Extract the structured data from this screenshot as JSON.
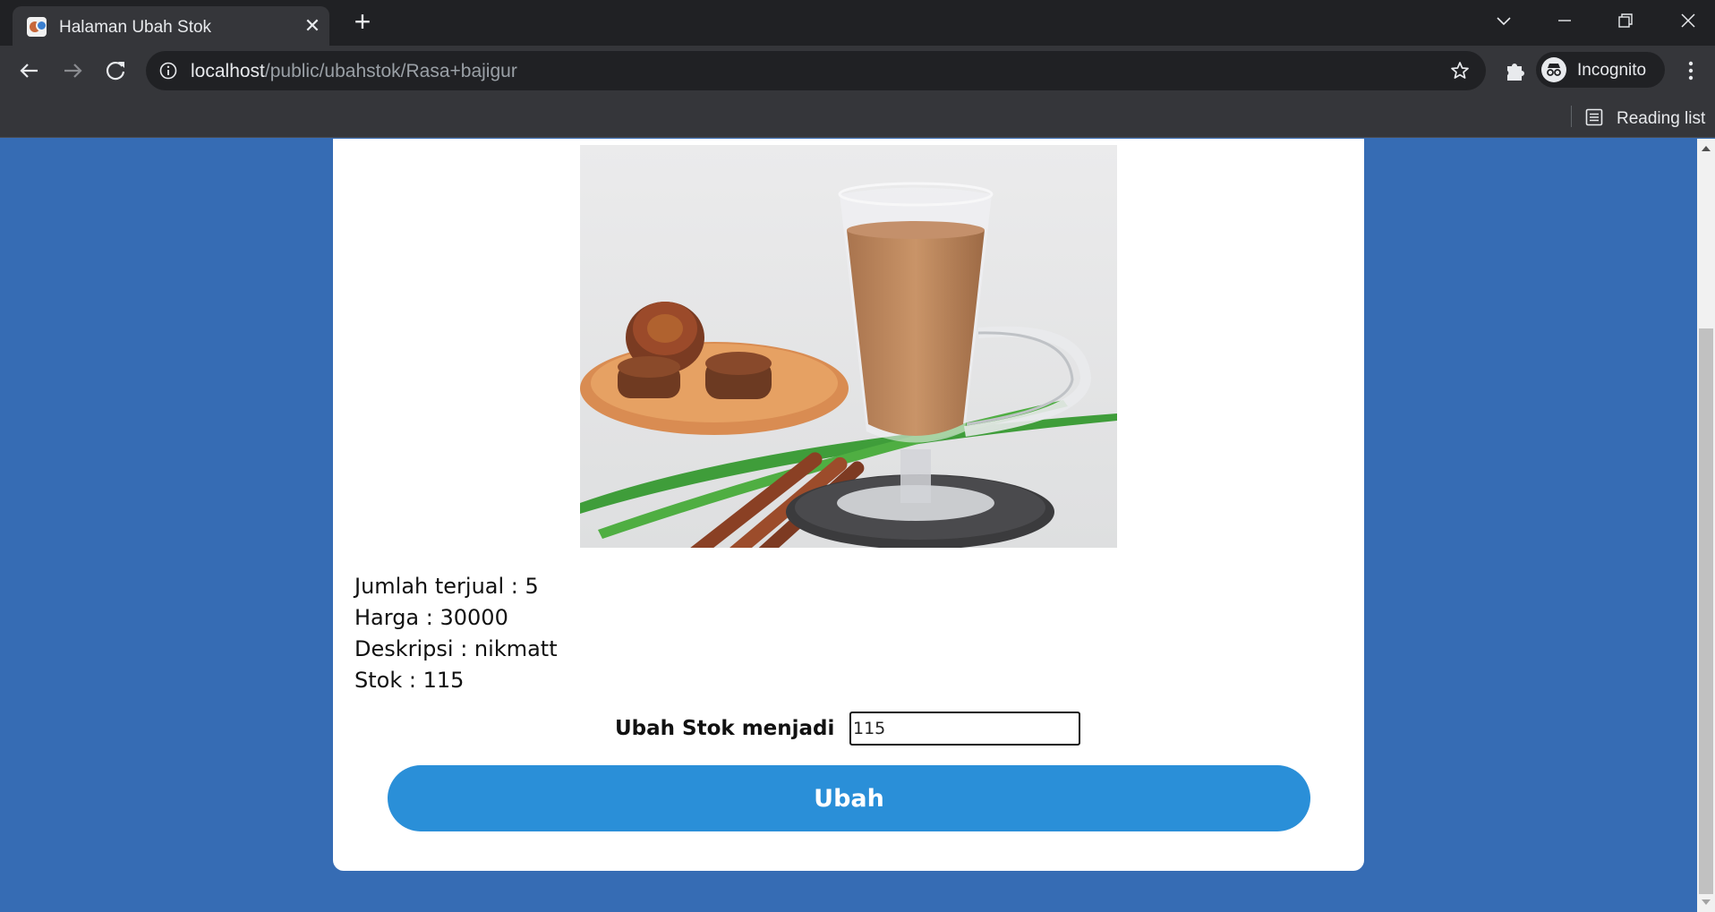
{
  "browser": {
    "tab_title": "Halaman Ubah Stok",
    "url_host": "localhost",
    "url_path": "/public/ubahstok/Rasa+bajigur",
    "profile_label": "Incognito",
    "reading_list_label": "Reading list"
  },
  "product": {
    "image_icon": "product-photo-bajigur",
    "sold_label": "Jumlah terjual : 5",
    "price_label": "Harga : 30000",
    "description_label": "Deskripsi : nikmatt",
    "stock_label": "Stok : 115"
  },
  "form": {
    "label": "Ubah Stok menjadi",
    "stock_value": "115",
    "submit_label": "Ubah"
  },
  "colors": {
    "page_background": "#366cb4",
    "button": "#2a8fd8"
  }
}
